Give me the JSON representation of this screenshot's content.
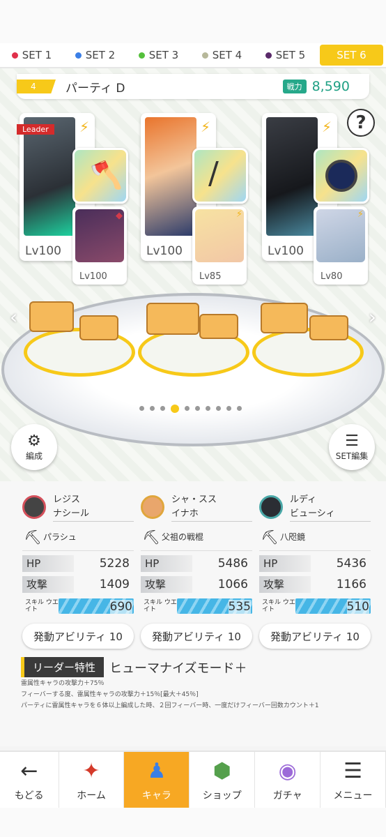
{
  "tabs": [
    {
      "label": "SET 1",
      "color": "#e0304a"
    },
    {
      "label": "SET 2",
      "color": "#3b7fe6"
    },
    {
      "label": "SET 3",
      "color": "#55c03c"
    },
    {
      "label": "SET 4",
      "color": "#b7b89a"
    },
    {
      "label": "SET 5",
      "color": "#5a2a6a"
    },
    {
      "label": "SET 6",
      "color": "#f7c919"
    }
  ],
  "active_tab": "SET 6",
  "party": {
    "number": "4",
    "name": "パーティ D",
    "power_label": "戦力",
    "power_value": "8,590"
  },
  "help_icon": "?",
  "leader_tag": "Leader",
  "cards": [
    {
      "main_lv": "Lv100",
      "sub_lv": "Lv100"
    },
    {
      "main_lv": "Lv100",
      "sub_lv": "Lv85"
    },
    {
      "main_lv": "Lv100",
      "sub_lv": "Lv80"
    }
  ],
  "round_buttons": {
    "formation": "編成",
    "set_edit": "SET編集"
  },
  "characters": [
    {
      "name": "レジス",
      "sub": "ナシール",
      "weapon": "パラシュ",
      "hp_label": "HP",
      "hp": "5228",
      "atk_label": "攻撃",
      "atk": "1409",
      "sw_label": "スキル ウエイト",
      "sw": "690",
      "ability": "発動アビリティ 10",
      "ring": "#d4505b"
    },
    {
      "name": "シャ・スス",
      "sub": "イナホ",
      "weapon": "父祖の戦棍",
      "hp_label": "HP",
      "hp": "5486",
      "atk_label": "攻撃",
      "atk": "1066",
      "sw_label": "スキル ウエイト",
      "sw": "535",
      "ability": "発動アビリティ 10",
      "ring": "#e0a63c"
    },
    {
      "name": "ルディ",
      "sub": "ビューシィ",
      "weapon": "八咫鏡",
      "hp_label": "HP",
      "hp": "5436",
      "atk_label": "攻撃",
      "atk": "1166",
      "sw_label": "スキル ウエイト",
      "sw": "510",
      "ability": "発動アビリティ 10",
      "ring": "#4aa8a8"
    }
  ],
  "leader_trait": {
    "label": "リーダー特性",
    "name": "ヒューマナイズモード＋",
    "lines": [
      "雷属性キャラの攻撃力＋75％",
      "フィーバーする度、雷属性キャラの攻撃力＋15％[最大＋45％]",
      "パーティに雷属性キャラを６体以上編成した時、２回フィーバー時、一度だけフィーバー回数カウント＋1"
    ]
  },
  "nav": [
    {
      "label": "もどる",
      "icon": "back-arrow-icon"
    },
    {
      "label": "ホーム",
      "icon": "home-icon"
    },
    {
      "label": "キャラ",
      "icon": "chara-icon"
    },
    {
      "label": "ショップ",
      "icon": "shop-icon"
    },
    {
      "label": "ガチャ",
      "icon": "gacha-icon"
    },
    {
      "label": "メニュー",
      "icon": "menu-icon"
    }
  ]
}
